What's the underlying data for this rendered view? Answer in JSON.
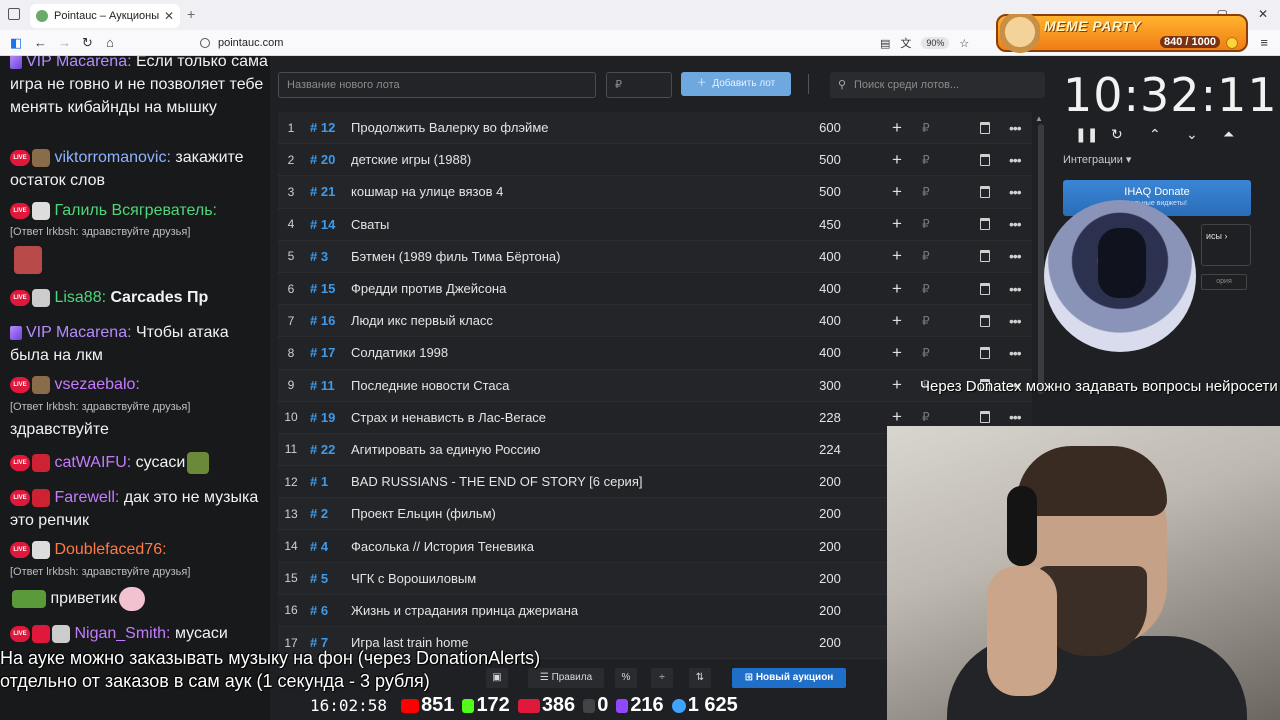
{
  "browser": {
    "tab_title": "Pointauc – Аукционы, лотереи",
    "tab_close": "✕",
    "new_tab": "+",
    "url": "pointauc.com",
    "zoom": "90%",
    "win_min": "—",
    "win_max": "▢",
    "win_close": "✕"
  },
  "meme_party": {
    "title": "MEME PARTY",
    "count": "840 / 1000"
  },
  "chat": {
    "messages": [
      {
        "user": "VIP Macarena:",
        "text": "Если только сама игра не говно и не позволяет тебе менять кибайнды на мышку",
        "color": "#b58cff"
      },
      {
        "user": "viktorromanovic:",
        "text": "закажите остаток слов",
        "color": "#8fb3ff"
      },
      {
        "user": "Галиль Всягреватель:",
        "reply": "[Ответ lrkbsh: здравствуйте друзья]",
        "color": "#4fd67a"
      },
      {
        "user": "Lisa88:",
        "text": "Carcades Пр",
        "color": "#4fd67a"
      },
      {
        "user": "VIP Macarena:",
        "text": "Чтобы атака была на лкм",
        "color": "#b58cff"
      },
      {
        "user": "vsezaebalo:",
        "reply": "[Ответ lrkbsh: здравствуйте друзья]",
        "text": "здравствуйте",
        "color": "#c57bff"
      },
      {
        "user": "catWAIFU:",
        "text": "сусаси",
        "color": "#c57bff"
      },
      {
        "user": "Farewell:",
        "text": "дак это не музыка это репчик",
        "color": "#c57bff"
      },
      {
        "user": "Doublefaced76:",
        "reply": "[Ответ lrkbsh: здравствуйте друзья]",
        "color": "#ff7a45"
      },
      {
        "user": "",
        "text": "приветик",
        "color": "#ffffff"
      },
      {
        "user": "Nigan_Smith:",
        "text": "мусаси",
        "color": "#c57bff"
      }
    ]
  },
  "app": {
    "lot_placeholder": "Название нового лота",
    "price_placeholder": "₽",
    "add_button": "Добавить лот",
    "search_placeholder": "Поиск среди лотов...",
    "rub": "₽",
    "lots": [
      {
        "idx": "1",
        "id": "# 12",
        "name": "Продолжить Валерку во флэйме",
        "value": "600"
      },
      {
        "idx": "2",
        "id": "# 20",
        "name": "детские игры (1988)",
        "value": "500"
      },
      {
        "idx": "3",
        "id": "# 21",
        "name": "кошмар на улице вязов 4",
        "value": "500"
      },
      {
        "idx": "4",
        "id": "# 14",
        "name": "Сваты",
        "value": "450"
      },
      {
        "idx": "5",
        "id": "# 3",
        "name": "Бэтмен (1989 филь Тима Бёртона)",
        "value": "400"
      },
      {
        "idx": "6",
        "id": "# 15",
        "name": "Фредди против Джейсона",
        "value": "400"
      },
      {
        "idx": "7",
        "id": "# 16",
        "name": "Люди икс первый класс",
        "value": "400"
      },
      {
        "idx": "8",
        "id": "# 17",
        "name": "Солдатики 1998",
        "value": "400"
      },
      {
        "idx": "9",
        "id": "# 11",
        "name": "Последние новости Стаса",
        "value": "300"
      },
      {
        "idx": "10",
        "id": "# 19",
        "name": "Страх и ненависть в Лас-Вегасе",
        "value": "228"
      },
      {
        "idx": "11",
        "id": "# 22",
        "name": "Агитировать за единую Россию",
        "value": "224"
      },
      {
        "idx": "12",
        "id": "# 1",
        "name": "BAD RUSSIANS - THE END OF STORY [6 серия]",
        "value": "200"
      },
      {
        "idx": "13",
        "id": "# 2",
        "name": "Проект Ельцин (фильм)",
        "value": "200"
      },
      {
        "idx": "14",
        "id": "# 4",
        "name": "Фасолька // История Теневика",
        "value": "200"
      },
      {
        "idx": "15",
        "id": "# 5",
        "name": "ЧГК с Ворошиловым",
        "value": "200"
      },
      {
        "idx": "16",
        "id": "# 6",
        "name": "Жизнь и страдания принца джериана",
        "value": "200"
      },
      {
        "idx": "17",
        "id": "# 7",
        "name": "Игра last train home",
        "value": "200"
      }
    ],
    "toolbar": {
      "rules": "Правила",
      "percent": "%",
      "new_auction": "Новый аукцион"
    }
  },
  "right_panel": {
    "timer": "10:32:11",
    "integrations": "Интеграции",
    "ihaq_title": "IHAQ Donate",
    "ihaq_sub": "кальные виджеты!",
    "panel2": "исы",
    "panel3": "ория"
  },
  "overlays": {
    "donatex": "Через Donatex можно задавать вопросы нейросети",
    "bottom_line1": "На ауке можно заказывать музыку на фон (через DonationAlerts)",
    "bottom_line2": "отдельно от заказов в сам аук (1 секунда - 3 рубля)"
  },
  "stats": {
    "time": "16:02:58",
    "youtube": "851",
    "kick": "172",
    "live": "386",
    "rumble": "0",
    "twitch": "216",
    "viewers": "1 625"
  },
  "colors": {
    "accent_blue": "#3f9ae8",
    "add_button": "#6fa7df",
    "new_auction": "#1f6fc9",
    "live_badge": "#e0183b"
  }
}
